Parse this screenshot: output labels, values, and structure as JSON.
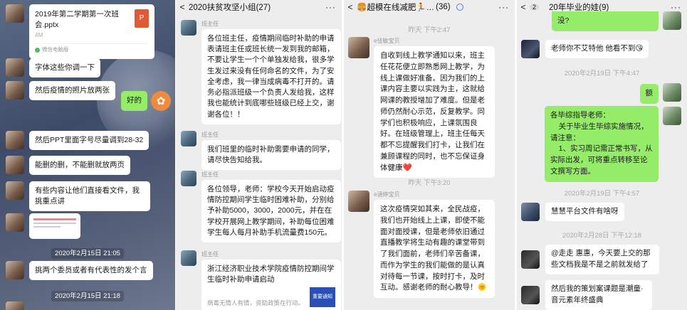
{
  "panel1": {
    "file": {
      "name": "2019年第二学期第一次班会.pptx",
      "size": "4M",
      "source": "微信电脑版",
      "icon_letter": "P"
    },
    "messages": [
      {
        "text": "字体这些你调一下"
      },
      {
        "text": "然后疫情的照片放两张"
      },
      {
        "text": "好的",
        "self": true
      },
      {
        "text": "然后PPT里面字号尽量调到28-32"
      },
      {
        "text": "能删的删，不能删就放两页"
      },
      {
        "text": "有些内容让他们直接看文件，我挑重点讲"
      },
      {
        "text": "挑两个委员或者有代表性的发个言"
      }
    ],
    "times": [
      "2020年2月15日 21:05",
      "2020年2月15日 21:18"
    ]
  },
  "panel2": {
    "title": "2020扶贫攻坚小组(27)",
    "back": "<",
    "more": "···",
    "messages": [
      {
        "sender": "班主任",
        "text": "各位班主任，疫情期间临时补助的申请表请班主任或班长统一发到我的邮箱，不要让学生一个个单独发给我，很多学生发过来没有任何命名的文件，为了安全考虑，我一律当成病毒不打开的。请务必指派班级一个负责人发给我，这样我也能统计到底哪些班级已经上交，谢谢各位！！"
      },
      {
        "sender": "班主任",
        "text": "我们班里的临时补助需要申请的同学，请尽快告知给我。"
      },
      {
        "sender": "班主任",
        "text": "各位领导，老师：学校今天开始启动疫情防控期间学生临时困难补助，分别给予补助5000，3000，2000元，并在在学校开展网上教学期间，补助每位困难学生每人每月补助手机流量费150元。"
      },
      {
        "sender": "班主任",
        "text": "浙江经济职业技术学院疫情防控期间学生临时补助申请启动",
        "sub": "病毒无情人有情，资助政策在行动。",
        "thumb": "重要通知"
      }
    ]
  },
  "panel3": {
    "title": "🍔超模在线减肥🏃‍…",
    "count": "(36)",
    "more": "···",
    "times": [
      "昨天 下午2:47",
      "昨天 下午3:20"
    ],
    "messages": [
      {
        "sender": "e佳敏宝贝",
        "text": "自收到线上教学通知以来，班主任花花便立即熟悉网上教学，为线上课做好准备。因为我们的上课内容主要以实践为主，这就给网课的教授增加了难度。但是老师仍然耐心示范，反复教学。同学们也积极响应，上课氛围良好。在班级管理上，班主任每天都不忘提醒我们打卡，让我们在兼顾课程的同时，也不忘保证身体健康❤️"
      },
      {
        "sender": "e涵婷宝贝",
        "text": "这次疫情突如其来，全民战疫，我们也开始线上上课，即使不能面对面授课，但是老师依旧通过直播教学将生动有趣的课堂带到了我们面前，老师们辛苦备课，而作为学生的我们能做的是认真对待每一节课，按时打卡，及时互动。感谢老师的耐心教导！🌞"
      }
    ]
  },
  "panel4": {
    "back_badge": "2",
    "title": "20年毕业的娃(9)",
    "more": "···",
    "times": [
      "2020年2月19日 下午4:47",
      "2020年2月19日 下午4:57",
      "2020年2月28日 下午12:18"
    ],
    "messages": [
      {
        "text": "没?",
        "self": true
      },
      {
        "text": "老师你不艾特他 他看不到😘"
      },
      {
        "text": "额",
        "self": true
      },
      {
        "text": "各毕综指导老师：\n    关于毕业生毕综实施情况，请注意：\n    1、实习周记需正常书写，从实际出发，可将重点转移至论文撰写方面。",
        "self": true
      },
      {
        "text": "慧慧平台文件有啥呀"
      },
      {
        "text": "@走走 惠惠，今天要上交的那些文档我是不是之前就发给了"
      },
      {
        "text": "然后我的策划案课题是潮童·音元素年终盛典"
      }
    ]
  }
}
